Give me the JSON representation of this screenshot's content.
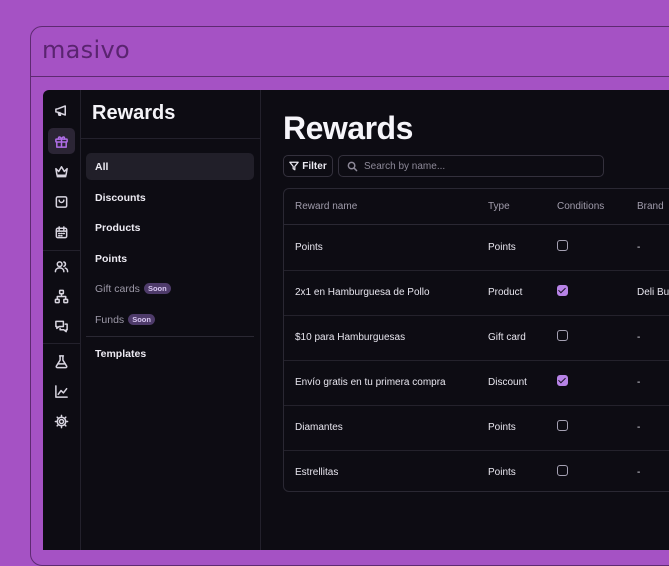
{
  "window": {
    "title": "masivo"
  },
  "rail": {
    "items": [
      {
        "icon": "megaphone-icon"
      },
      {
        "icon": "gift-icon",
        "active": true
      },
      {
        "icon": "crown-icon"
      },
      {
        "icon": "shopping-bag-icon"
      },
      {
        "icon": "calendar-icon"
      },
      {
        "icon": "users-icon"
      },
      {
        "icon": "hierarchy-icon"
      },
      {
        "icon": "chat-icon"
      },
      {
        "icon": "flask-icon"
      },
      {
        "icon": "chart-icon"
      },
      {
        "icon": "gear-icon"
      }
    ]
  },
  "subnav": {
    "title": "Rewards",
    "items": [
      {
        "label": "All",
        "active": true
      },
      {
        "label": "Discounts"
      },
      {
        "label": "Products"
      },
      {
        "label": "Points"
      },
      {
        "label": "Gift cards",
        "badge": "Soon",
        "muted": true
      },
      {
        "label": "Funds",
        "badge": "Soon",
        "muted": true
      },
      {
        "label": "Templates"
      }
    ]
  },
  "main": {
    "title": "Rewards",
    "filter_label": "Filter",
    "search_placeholder": "Search by name..."
  },
  "table": {
    "columns": [
      "Reward name",
      "Type",
      "Conditions",
      "Brand"
    ],
    "rows": [
      {
        "name": "Points",
        "type": "Points",
        "conditions": false,
        "brand": "-"
      },
      {
        "name": "2x1 en Hamburguesa de Pollo",
        "type": "Product",
        "conditions": true,
        "brand": "Deli Bu"
      },
      {
        "name": "$10 para Hamburguesas",
        "type": "Gift card",
        "conditions": false,
        "brand": "-"
      },
      {
        "name": "Envío gratis en tu primera compra",
        "type": "Discount",
        "conditions": true,
        "brand": "-"
      },
      {
        "name": "Diamantes",
        "type": "Points",
        "conditions": false,
        "brand": "-"
      },
      {
        "name": "Estrellitas",
        "type": "Points",
        "conditions": false,
        "brand": "-"
      }
    ]
  },
  "colors": {
    "background": "#a552c4",
    "app": "#0d0c13",
    "accent": "#b783e6"
  }
}
